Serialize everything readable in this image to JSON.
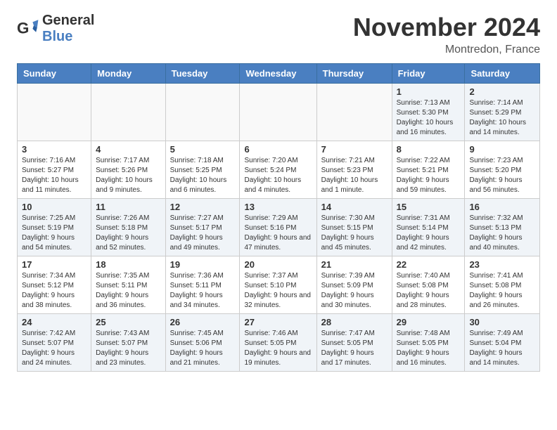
{
  "header": {
    "logo": {
      "general": "General",
      "blue": "Blue"
    },
    "title": "November 2024",
    "location": "Montredon, France"
  },
  "calendar": {
    "days_of_week": [
      "Sunday",
      "Monday",
      "Tuesday",
      "Wednesday",
      "Thursday",
      "Friday",
      "Saturday"
    ],
    "weeks": [
      [
        {
          "day": "",
          "info": ""
        },
        {
          "day": "",
          "info": ""
        },
        {
          "day": "",
          "info": ""
        },
        {
          "day": "",
          "info": ""
        },
        {
          "day": "",
          "info": ""
        },
        {
          "day": "1",
          "info": "Sunrise: 7:13 AM\nSunset: 5:30 PM\nDaylight: 10 hours and 16 minutes."
        },
        {
          "day": "2",
          "info": "Sunrise: 7:14 AM\nSunset: 5:29 PM\nDaylight: 10 hours and 14 minutes."
        }
      ],
      [
        {
          "day": "3",
          "info": "Sunrise: 7:16 AM\nSunset: 5:27 PM\nDaylight: 10 hours and 11 minutes."
        },
        {
          "day": "4",
          "info": "Sunrise: 7:17 AM\nSunset: 5:26 PM\nDaylight: 10 hours and 9 minutes."
        },
        {
          "day": "5",
          "info": "Sunrise: 7:18 AM\nSunset: 5:25 PM\nDaylight: 10 hours and 6 minutes."
        },
        {
          "day": "6",
          "info": "Sunrise: 7:20 AM\nSunset: 5:24 PM\nDaylight: 10 hours and 4 minutes."
        },
        {
          "day": "7",
          "info": "Sunrise: 7:21 AM\nSunset: 5:23 PM\nDaylight: 10 hours and 1 minute."
        },
        {
          "day": "8",
          "info": "Sunrise: 7:22 AM\nSunset: 5:21 PM\nDaylight: 9 hours and 59 minutes."
        },
        {
          "day": "9",
          "info": "Sunrise: 7:23 AM\nSunset: 5:20 PM\nDaylight: 9 hours and 56 minutes."
        }
      ],
      [
        {
          "day": "10",
          "info": "Sunrise: 7:25 AM\nSunset: 5:19 PM\nDaylight: 9 hours and 54 minutes."
        },
        {
          "day": "11",
          "info": "Sunrise: 7:26 AM\nSunset: 5:18 PM\nDaylight: 9 hours and 52 minutes."
        },
        {
          "day": "12",
          "info": "Sunrise: 7:27 AM\nSunset: 5:17 PM\nDaylight: 9 hours and 49 minutes."
        },
        {
          "day": "13",
          "info": "Sunrise: 7:29 AM\nSunset: 5:16 PM\nDaylight: 9 hours and 47 minutes."
        },
        {
          "day": "14",
          "info": "Sunrise: 7:30 AM\nSunset: 5:15 PM\nDaylight: 9 hours and 45 minutes."
        },
        {
          "day": "15",
          "info": "Sunrise: 7:31 AM\nSunset: 5:14 PM\nDaylight: 9 hours and 42 minutes."
        },
        {
          "day": "16",
          "info": "Sunrise: 7:32 AM\nSunset: 5:13 PM\nDaylight: 9 hours and 40 minutes."
        }
      ],
      [
        {
          "day": "17",
          "info": "Sunrise: 7:34 AM\nSunset: 5:12 PM\nDaylight: 9 hours and 38 minutes."
        },
        {
          "day": "18",
          "info": "Sunrise: 7:35 AM\nSunset: 5:11 PM\nDaylight: 9 hours and 36 minutes."
        },
        {
          "day": "19",
          "info": "Sunrise: 7:36 AM\nSunset: 5:11 PM\nDaylight: 9 hours and 34 minutes."
        },
        {
          "day": "20",
          "info": "Sunrise: 7:37 AM\nSunset: 5:10 PM\nDaylight: 9 hours and 32 minutes."
        },
        {
          "day": "21",
          "info": "Sunrise: 7:39 AM\nSunset: 5:09 PM\nDaylight: 9 hours and 30 minutes."
        },
        {
          "day": "22",
          "info": "Sunrise: 7:40 AM\nSunset: 5:08 PM\nDaylight: 9 hours and 28 minutes."
        },
        {
          "day": "23",
          "info": "Sunrise: 7:41 AM\nSunset: 5:08 PM\nDaylight: 9 hours and 26 minutes."
        }
      ],
      [
        {
          "day": "24",
          "info": "Sunrise: 7:42 AM\nSunset: 5:07 PM\nDaylight: 9 hours and 24 minutes."
        },
        {
          "day": "25",
          "info": "Sunrise: 7:43 AM\nSunset: 5:07 PM\nDaylight: 9 hours and 23 minutes."
        },
        {
          "day": "26",
          "info": "Sunrise: 7:45 AM\nSunset: 5:06 PM\nDaylight: 9 hours and 21 minutes."
        },
        {
          "day": "27",
          "info": "Sunrise: 7:46 AM\nSunset: 5:05 PM\nDaylight: 9 hours and 19 minutes."
        },
        {
          "day": "28",
          "info": "Sunrise: 7:47 AM\nSunset: 5:05 PM\nDaylight: 9 hours and 17 minutes."
        },
        {
          "day": "29",
          "info": "Sunrise: 7:48 AM\nSunset: 5:05 PM\nDaylight: 9 hours and 16 minutes."
        },
        {
          "day": "30",
          "info": "Sunrise: 7:49 AM\nSunset: 5:04 PM\nDaylight: 9 hours and 14 minutes."
        }
      ]
    ]
  }
}
